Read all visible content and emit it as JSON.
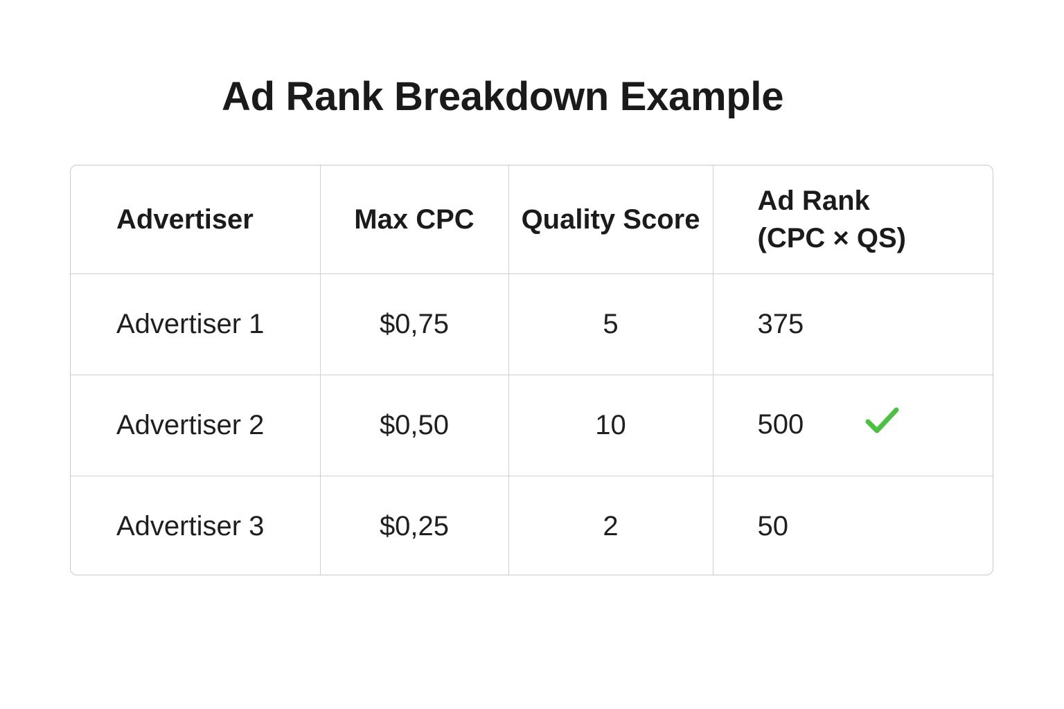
{
  "chart_data": {
    "type": "table",
    "title": "Ad Rank Breakdown Example",
    "columns": [
      "Advertiser",
      "Max CPC",
      "Quality Score",
      "Ad Rank (CPC × QS)"
    ],
    "header": {
      "advertiser": "Advertiser",
      "max_cpc": "Max CPC",
      "quality_score": "Quality Score",
      "ad_rank_line1": "Ad Rank",
      "ad_rank_line2": "(CPC × QS)"
    },
    "rows": [
      {
        "advertiser": "Advertiser 1",
        "max_cpc": "$0,75",
        "quality_score": "5",
        "ad_rank": "375",
        "winner": false
      },
      {
        "advertiser": "Advertiser 2",
        "max_cpc": "$0,50",
        "quality_score": "10",
        "ad_rank": "500",
        "winner": true
      },
      {
        "advertiser": "Advertiser 3",
        "max_cpc": "$0,25",
        "quality_score": "2",
        "ad_rank": "50",
        "winner": false
      }
    ],
    "winner_icon": "check-icon",
    "winner_color": "#4cc13f"
  }
}
